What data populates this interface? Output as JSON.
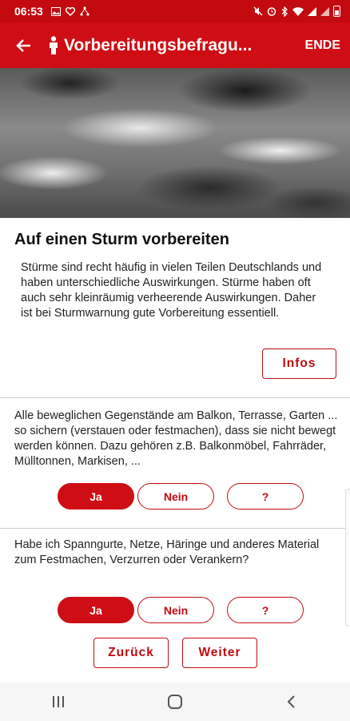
{
  "status_bar": {
    "time": "06:53",
    "left_icons": [
      "image-icon",
      "heart-icon",
      "network-icon"
    ],
    "right_icons": [
      "mute-icon",
      "alarm-icon",
      "bluetooth-icon",
      "wifi-icon",
      "signal-icon",
      "signal-icon",
      "battery-icon"
    ]
  },
  "app_bar": {
    "back_icon": "arrow-back-icon",
    "title_icon": "person-icon",
    "title": "Vorbereitungsbefragu...",
    "end_label": "ENDE"
  },
  "colors": {
    "primary": "#cf0d14",
    "status": "#c20a0f"
  },
  "intro": {
    "title": "Auf einen Sturm vorbereiten",
    "text": "Stürme sind recht häufig in vielen Teilen Deutschlands und haben unterschiedliche Auswirkungen. Stürme haben oft auch sehr kleinräumig verheerende Auswirkungen. Daher ist bei Sturmwarnung gute Vorbereitung essentiell.",
    "info_label": "Infos"
  },
  "questions": [
    {
      "text": "Alle beweglichen Gegenstände am Balkon, Terrasse, Garten ... so sichern (verstauen oder festmachen), dass sie nicht bewegt werden können. Dazu gehören z.B. Balkonmöbel, Fahrräder, Mülltonnen, Markisen, ...",
      "options": [
        "Ja",
        "Nein",
        "?"
      ],
      "selected": "Ja"
    },
    {
      "text": "Habe ich Spanngurte, Netze, Häringe und anderes Material zum Festmachen, Verzurren oder Verankern?",
      "options": [
        "Ja",
        "Nein",
        "?"
      ],
      "selected": "Ja"
    }
  ],
  "nav": {
    "back_label": "Zurück",
    "next_label": "Weiter"
  },
  "system_nav": [
    "recent-apps-icon",
    "home-icon",
    "back-icon"
  ]
}
